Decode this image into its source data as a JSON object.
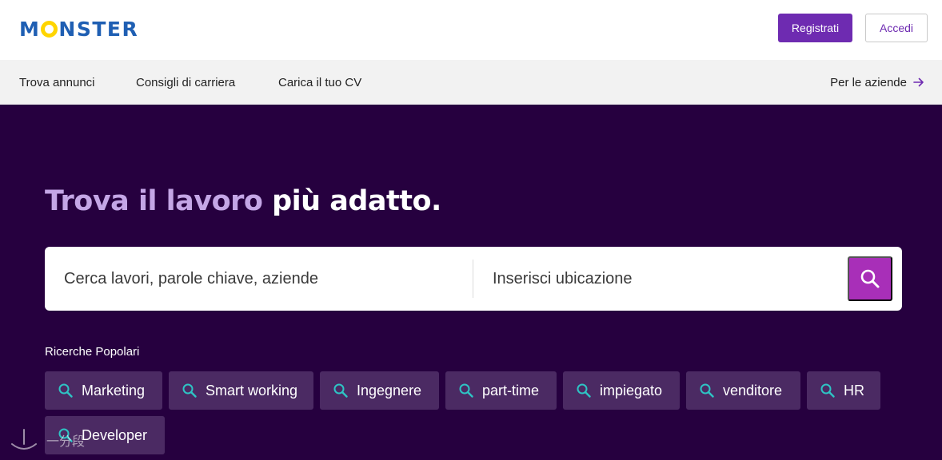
{
  "header": {
    "logo_letters": [
      "M",
      "N",
      "S",
      "T",
      "E",
      "R"
    ],
    "register_label": "Registrati",
    "login_label": "Accedi"
  },
  "nav": {
    "items": [
      "Trova annunci",
      "Consigli di carriera",
      "Carica il tuo CV"
    ],
    "employers_label": "Per le aziende",
    "employers_icon": "arrow-right-icon"
  },
  "hero": {
    "title_part1": "Trova il lavoro",
    "title_part2": "più adatto."
  },
  "search": {
    "keywords_placeholder": "Cerca lavori, parole chiave, aziende",
    "location_placeholder": "Inserisci ubicazione",
    "button_icon": "search-icon"
  },
  "popular": {
    "label": "Ricerche Popolari",
    "chips": [
      "Marketing",
      "Smart working",
      "Ingegnere",
      "part-time",
      "impiegato",
      "venditore",
      "HR",
      "Developer"
    ]
  },
  "watermark": {
    "text": "一分段"
  },
  "colors": {
    "brand_blue": "#1f5fb3",
    "brand_yellow": "#ffd500",
    "accent_purple": "#6e2bb1",
    "hero_bg": "#26003f",
    "search_button": "#a82fb8",
    "chip_bg": "#4b2a63",
    "chip_icon": "#2ec4c4",
    "title_light": "#c4a6e6"
  }
}
